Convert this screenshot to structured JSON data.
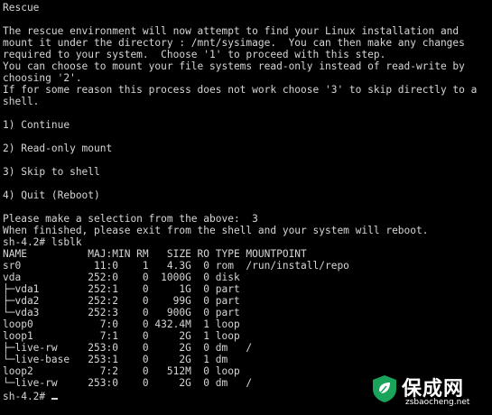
{
  "terminal": {
    "lines": [
      "Rescue",
      "",
      "The rescue environment will now attempt to find your Linux installation and",
      "mount it under the directory : /mnt/sysimage.  You can then make any changes",
      "required to your system.  Choose '1' to proceed with this step.",
      "You can choose to mount your file systems read-only instead of read-write by",
      "choosing '2'.",
      "If for some reason this process does not work choose '3' to skip directly to a",
      "shell.",
      "",
      "1) Continue",
      "",
      "2) Read-only mount",
      "",
      "3) Skip to shell",
      "",
      "4) Quit (Reboot)",
      "",
      "Please make a selection from the above:  3",
      "When finished, please exit from the shell and your system will reboot.",
      "sh-4.2# lsblk",
      "NAME          MAJ:MIN RM   SIZE RO TYPE MOUNTPOINT",
      "sr0            11:0    1   4.3G  0 rom  /run/install/repo",
      "vda           252:0    0  1000G  0 disk",
      "├─vda1        252:1    0     1G  0 part",
      "├─vda2        252:2    0    99G  0 part",
      "└─vda3        252:3    0   900G  0 part",
      "loop0           7:0    0 432.4M  1 loop",
      "loop1           7:1    0     2G  1 loop",
      "├─live-rw     253:0    0     2G  0 dm   /",
      "└─live-base   253:1    0     2G  1 dm",
      "loop2           7:2    0   512M  0 loop",
      "└─live-rw     253:0    0     2G  0 dm   /"
    ],
    "prompt": "sh-4.2# ",
    "text_color": "#d6d6d6",
    "background_color": "#000000"
  },
  "watermark": {
    "title": "保成网",
    "url": "zsbaocheng.net",
    "logo_icon": "shield-leaf-icon",
    "logo_color": "#1aa35a"
  }
}
